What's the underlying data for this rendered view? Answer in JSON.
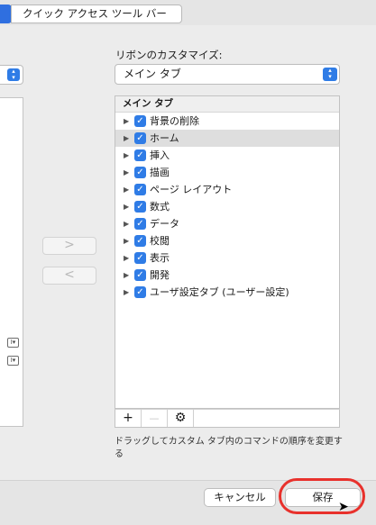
{
  "tabs": {
    "quick_access": "クイック アクセス ツール バー"
  },
  "customize": {
    "label": "リボンのカスタマイズ:",
    "selected": "メイン タブ"
  },
  "tree": {
    "header": "メイン タブ",
    "items": [
      {
        "label": "背景の削除",
        "checked": true
      },
      {
        "label": "ホーム",
        "checked": true,
        "selected": true
      },
      {
        "label": "挿入",
        "checked": true
      },
      {
        "label": "描画",
        "checked": true
      },
      {
        "label": "ページ レイアウト",
        "checked": true
      },
      {
        "label": "数式",
        "checked": true
      },
      {
        "label": "データ",
        "checked": true
      },
      {
        "label": "校閲",
        "checked": true
      },
      {
        "label": "表示",
        "checked": true
      },
      {
        "label": "開発",
        "checked": true
      },
      {
        "label": "ユーザ設定タブ (ユーザー設定)",
        "checked": true
      }
    ]
  },
  "toolbar": {
    "add": "+",
    "remove": "—",
    "settings": "⚙"
  },
  "move": {
    "right": ">",
    "left": "<"
  },
  "hint": "ドラッグしてカスタム タブ内のコマンドの順序を変更する",
  "footer": {
    "cancel": "キャンセル",
    "save": "保存"
  },
  "colors": {
    "accent": "#2f7ce6",
    "highlight_ring": "#e8312c"
  }
}
